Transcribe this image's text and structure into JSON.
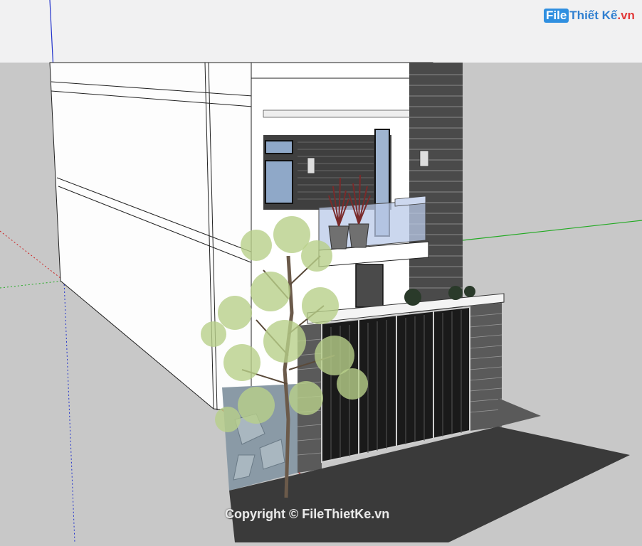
{
  "scene": {
    "sky_color": "#f1f1f2",
    "ground_color": "#c8c8c8",
    "axis_red": "#cc2222",
    "axis_green": "#22aa22",
    "axis_blue": "#2222cc"
  },
  "watermark_logo": {
    "file_text": "File",
    "brand_text": "Thiết Kế",
    "suffix_text": ".vn"
  },
  "copyright": {
    "text": "Copyright © FileThietKe.vn"
  },
  "model": {
    "wall_color": "#ffffff",
    "cladding_color": "#4a4a4a",
    "gate_color": "#1a1a1a",
    "tree_leaf_color": "#b8cf8a",
    "stone_wall_color": "#8a9aa6",
    "ground_slab_color": "#3a3a3a"
  }
}
